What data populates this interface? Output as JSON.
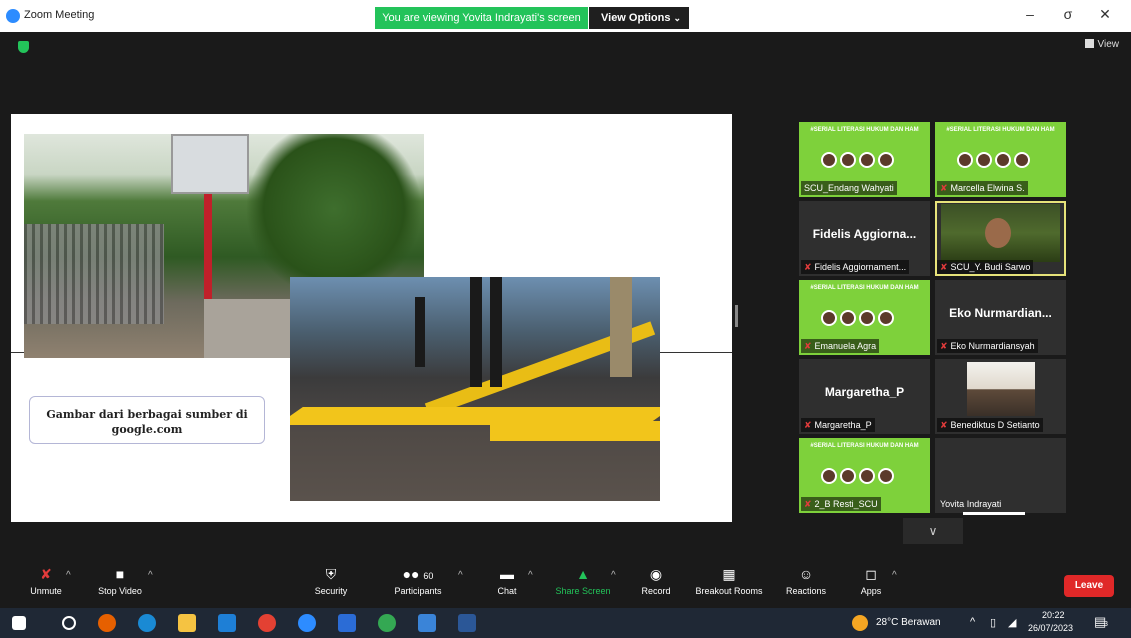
{
  "window": {
    "title": "Zoom Meeting",
    "minimize": "–",
    "maximize": "σ",
    "close": "✕"
  },
  "banner": {
    "text": "You are viewing Yovita Indrayati's screen",
    "view_options": "View Options",
    "chevron": "⌄"
  },
  "top_right": {
    "view": "View"
  },
  "slide": {
    "caption": "Gambar dari berbagai sumber di google.com"
  },
  "gallery": {
    "poster_head": "#SERIAL LITERASI HUKUM DAN HAM",
    "tiles": [
      {
        "label": "SCU_Endang Wahyati"
      },
      {
        "label": "Marcella Elwina S."
      },
      {
        "big": "Fidelis Aggiorna...",
        "label": "Fidelis Aggiornament..."
      },
      {
        "label": "SCU_Y. Budi Sarwo"
      },
      {
        "label": "Emanuela Agra"
      },
      {
        "big": "Eko Nurmardian...",
        "label": "Eko Nurmardiansyah"
      },
      {
        "big": "Margaretha_P",
        "label": "Margaretha_P"
      },
      {
        "label": "Benediktus D Setianto"
      },
      {
        "label": "2_B Resti_SCU"
      },
      {
        "label": "Yovita Indrayati"
      }
    ],
    "scroll": "∨"
  },
  "toolbar": {
    "unmute": "Unmute",
    "stop_video": "Stop Video",
    "security": "Security",
    "participants": "Participants",
    "participants_count": "60",
    "chat": "Chat",
    "share_screen": "Share Screen",
    "record": "Record",
    "breakout": "Breakout Rooms",
    "reactions": "Reactions",
    "apps": "Apps",
    "leave": "Leave",
    "caret": "^"
  },
  "taskbar": {
    "weather": "28°C Berawan",
    "time": "20:22",
    "date": "26/07/2023",
    "notif_count": "3"
  }
}
